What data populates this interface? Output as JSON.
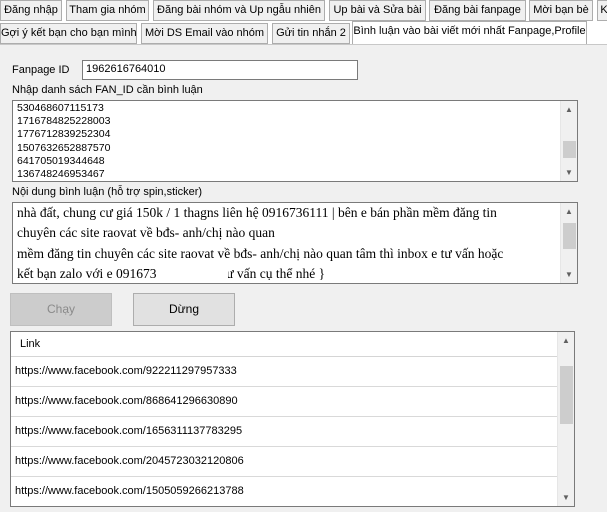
{
  "tabs_row1": [
    {
      "label": "Đăng nhập"
    },
    {
      "label": "Tham gia nhóm"
    },
    {
      "label": "Đăng bài nhóm và Up ngẫu nhiên"
    },
    {
      "label": "Up bài và Sửa bài"
    },
    {
      "label": "Đăng bài fanpage"
    },
    {
      "label": "Mời bạn bè"
    },
    {
      "label": "K"
    }
  ],
  "tabs_row2": [
    {
      "label": "Gợi ý kết bạn cho bạn mình"
    },
    {
      "label": "Mời DS Email vào nhóm"
    },
    {
      "label": "Gửi tin nhắn 2"
    },
    {
      "label": "Bình luận vào bài viết mới nhất Fanpage,Profile"
    }
  ],
  "form": {
    "fanpage_label": "Fanpage ID",
    "fanpage_value": "1962616764010",
    "fan_ids_label": "Nhập danh sách FAN_ID cần bình luận",
    "fan_ids": [
      "530468607115173",
      "1716784825228003",
      "1776712839252304",
      "1507632652887570",
      "641705019344648",
      "136748246953467"
    ],
    "comment_label": "Nội dung bình luận (hỗ trợ spin,sticker)",
    "comment_lines": [
      "nhà đất, chung cư giá 150k / 1 thagns liên hệ 0916736111 | bên e bán phần mềm đăng tin",
      "chuyên các site raovat về bđs- anh/chị nào quan                   bên e bán phần",
      "mềm đăng tin chuyên các site raovat về bđs- anh/chị nào quan tâm thì inbox e tư vấn hoặc",
      "kết bạn zalo với e 091673            để e tư vấn cụ thể nhé }"
    ]
  },
  "buttons": {
    "run_label": "Chạy",
    "stop_label": "Dừng"
  },
  "grid": {
    "column_header": "Link",
    "rows": [
      "https://www.facebook.com/922211297957333",
      "https://www.facebook.com/868641296630890",
      "https://www.facebook.com/1656311137783295",
      "https://www.facebook.com/2045723032120806",
      "https://www.facebook.com/1505059266213788"
    ]
  }
}
